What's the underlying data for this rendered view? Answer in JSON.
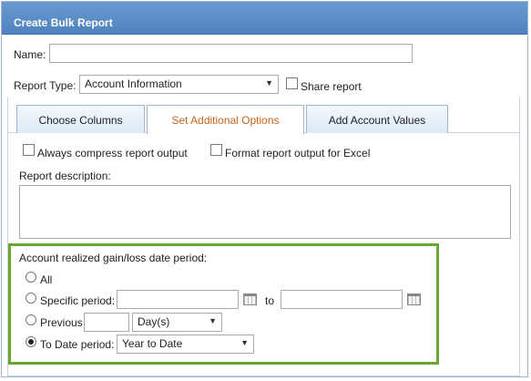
{
  "dialog": {
    "title": "Create Bulk Report"
  },
  "form": {
    "name_label": "Name:",
    "name_value": "",
    "report_type_label": "Report Type:",
    "report_type_value": "Account Information",
    "share_report_label": "Share report",
    "share_report_checked": false
  },
  "tabs": [
    {
      "label": "Choose Columns",
      "active": false
    },
    {
      "label": "Set Additional Options",
      "active": true
    },
    {
      "label": "Add Account Values",
      "active": false
    }
  ],
  "options": {
    "compress_label": "Always compress report output",
    "compress_checked": false,
    "excel_label": "Format report output for Excel",
    "excel_checked": false,
    "description_label": "Report description:",
    "description_value": ""
  },
  "period": {
    "heading": "Account realized gain/loss date period:",
    "all_label": "All",
    "specific_label": "Specific period:",
    "to_label": "to",
    "previous_label": "Previous",
    "previous_value": "",
    "previous_unit": "Day(s)",
    "to_date_label": "To Date period:",
    "to_date_value": "Year to Date",
    "selected": "To Date period"
  },
  "colors": {
    "titlebar": "#5a8cc7",
    "active_tab_text": "#c0651e",
    "highlight_border": "#67a62f"
  }
}
